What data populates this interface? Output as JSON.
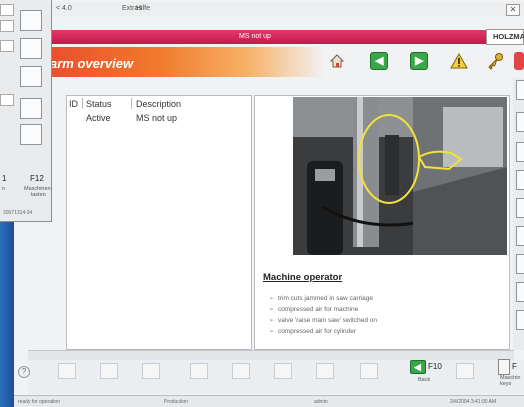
{
  "menubar": {
    "version": "< 4.0",
    "menu_extras": "Extras",
    "menu_help": "Hilfe"
  },
  "title_bar": {
    "text": "MS not up"
  },
  "brand": {
    "text": "HOLZMA"
  },
  "banner": {
    "title": "arm overview"
  },
  "toolbar": {
    "icons": [
      "home-icon",
      "back-arrow-icon",
      "forward-arrow-icon",
      "warning-icon",
      "key-icon",
      "exit-icon"
    ]
  },
  "side_dialog": {
    "f11_key": "1",
    "f11_sub": "n",
    "f12_key": "F12",
    "f12_sub": "Maschinen-\ntasten",
    "stamp": "20071314:34"
  },
  "alarm_table": {
    "headers": {
      "id": "ID",
      "status": "Status",
      "description": "Description"
    },
    "rows": [
      {
        "status": "Active",
        "description": "MS not up"
      }
    ]
  },
  "detail": {
    "heading": "Machine operator",
    "items": [
      "trim cuts jammed in saw carriage",
      "compressed air for machine",
      "valve 'raise main saw' switched on",
      "compressed air for cylinder"
    ]
  },
  "fkeys": {
    "f10_label": "F10",
    "f10_sub": "Back",
    "f11_label": "F",
    "f11_sub": "Maschin\nkeys"
  },
  "status_bar": {
    "state": "ready for operation",
    "mode": "Production",
    "user": "admin",
    "datetime": "2/4/2004 3:41:00 AM"
  },
  "colors": {
    "title_bar": "#d1245a",
    "banner_start": "#e8452e",
    "banner_end": "#f7b26a",
    "nav_green": "#3aa64a"
  }
}
